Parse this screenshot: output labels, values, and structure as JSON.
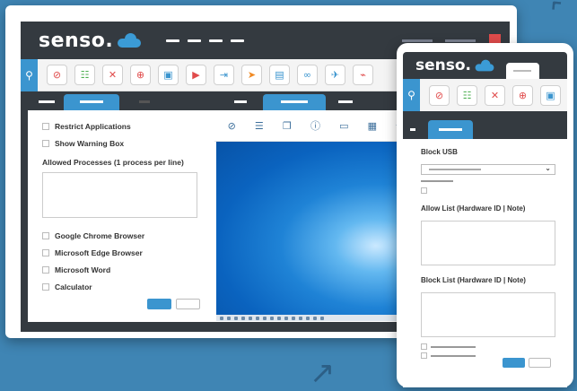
{
  "brand": {
    "name": "senso.",
    "accent": "#3b95cf",
    "dark": "#343a40",
    "danger": "#e04b4b"
  },
  "toolbar_icons": [
    {
      "name": "block-icon",
      "glyph": "⊘",
      "color": "#e04b4b"
    },
    {
      "name": "checklist-icon",
      "glyph": "☷",
      "color": "#4caf50"
    },
    {
      "name": "mute-icon",
      "glyph": "✕",
      "color": "#e04b4b"
    },
    {
      "name": "globe-icon",
      "glyph": "⊕",
      "color": "#e04b4b"
    },
    {
      "name": "image-icon",
      "glyph": "▣",
      "color": "#3b95cf"
    },
    {
      "name": "video-icon",
      "glyph": "▶",
      "color": "#e04b4b"
    },
    {
      "name": "login-icon",
      "glyph": "⇥",
      "color": "#3b95cf"
    },
    {
      "name": "send-icon",
      "glyph": "➤",
      "color": "#f08a24"
    },
    {
      "name": "file-icon",
      "glyph": "▤",
      "color": "#3b95cf"
    },
    {
      "name": "link-icon",
      "glyph": "∞",
      "color": "#3b95cf"
    },
    {
      "name": "rocket-icon",
      "glyph": "✈",
      "color": "#3b95cf"
    },
    {
      "name": "usb-icon",
      "glyph": "⌁",
      "color": "#e04b4b"
    }
  ],
  "left_panel": {
    "options_top": [
      "Restrict Applications",
      "Show Warning Box"
    ],
    "processes_label": "Allowed Processes (1 process per line)",
    "options_bottom": [
      "Google Chrome Browser",
      "Microsoft Edge Browser",
      "Microsoft Word",
      "Calculator"
    ]
  },
  "screen_toolbar_icons": [
    {
      "name": "block-icon",
      "glyph": "⊘"
    },
    {
      "name": "tasks-icon",
      "glyph": "☰"
    },
    {
      "name": "copy-icon",
      "glyph": "❐"
    },
    {
      "name": "info-icon",
      "glyph": "ⓘ"
    },
    {
      "name": "monitor-icon",
      "glyph": "▭"
    },
    {
      "name": "qr-icon",
      "glyph": "▦"
    },
    {
      "name": "scan-icon",
      "glyph": "⌖"
    }
  ],
  "mobile": {
    "block_usb_label": "Block USB",
    "allow_list_label": "Allow List (Hardware ID | Note)",
    "block_list_label": "Block List (Hardware ID | Note)"
  }
}
